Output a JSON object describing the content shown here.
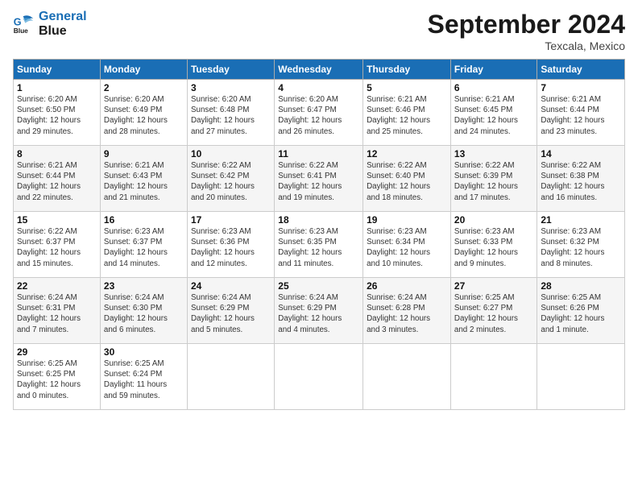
{
  "logo": {
    "line1": "General",
    "line2": "Blue"
  },
  "title": "September 2024",
  "subtitle": "Texcala, Mexico",
  "headers": [
    "Sunday",
    "Monday",
    "Tuesday",
    "Wednesday",
    "Thursday",
    "Friday",
    "Saturday"
  ],
  "weeks": [
    [
      {
        "day": "1",
        "info": "Sunrise: 6:20 AM\nSunset: 6:50 PM\nDaylight: 12 hours\nand 29 minutes."
      },
      {
        "day": "2",
        "info": "Sunrise: 6:20 AM\nSunset: 6:49 PM\nDaylight: 12 hours\nand 28 minutes."
      },
      {
        "day": "3",
        "info": "Sunrise: 6:20 AM\nSunset: 6:48 PM\nDaylight: 12 hours\nand 27 minutes."
      },
      {
        "day": "4",
        "info": "Sunrise: 6:20 AM\nSunset: 6:47 PM\nDaylight: 12 hours\nand 26 minutes."
      },
      {
        "day": "5",
        "info": "Sunrise: 6:21 AM\nSunset: 6:46 PM\nDaylight: 12 hours\nand 25 minutes."
      },
      {
        "day": "6",
        "info": "Sunrise: 6:21 AM\nSunset: 6:45 PM\nDaylight: 12 hours\nand 24 minutes."
      },
      {
        "day": "7",
        "info": "Sunrise: 6:21 AM\nSunset: 6:44 PM\nDaylight: 12 hours\nand 23 minutes."
      }
    ],
    [
      {
        "day": "8",
        "info": "Sunrise: 6:21 AM\nSunset: 6:44 PM\nDaylight: 12 hours\nand 22 minutes."
      },
      {
        "day": "9",
        "info": "Sunrise: 6:21 AM\nSunset: 6:43 PM\nDaylight: 12 hours\nand 21 minutes."
      },
      {
        "day": "10",
        "info": "Sunrise: 6:22 AM\nSunset: 6:42 PM\nDaylight: 12 hours\nand 20 minutes."
      },
      {
        "day": "11",
        "info": "Sunrise: 6:22 AM\nSunset: 6:41 PM\nDaylight: 12 hours\nand 19 minutes."
      },
      {
        "day": "12",
        "info": "Sunrise: 6:22 AM\nSunset: 6:40 PM\nDaylight: 12 hours\nand 18 minutes."
      },
      {
        "day": "13",
        "info": "Sunrise: 6:22 AM\nSunset: 6:39 PM\nDaylight: 12 hours\nand 17 minutes."
      },
      {
        "day": "14",
        "info": "Sunrise: 6:22 AM\nSunset: 6:38 PM\nDaylight: 12 hours\nand 16 minutes."
      }
    ],
    [
      {
        "day": "15",
        "info": "Sunrise: 6:22 AM\nSunset: 6:37 PM\nDaylight: 12 hours\nand 15 minutes."
      },
      {
        "day": "16",
        "info": "Sunrise: 6:23 AM\nSunset: 6:37 PM\nDaylight: 12 hours\nand 14 minutes."
      },
      {
        "day": "17",
        "info": "Sunrise: 6:23 AM\nSunset: 6:36 PM\nDaylight: 12 hours\nand 12 minutes."
      },
      {
        "day": "18",
        "info": "Sunrise: 6:23 AM\nSunset: 6:35 PM\nDaylight: 12 hours\nand 11 minutes."
      },
      {
        "day": "19",
        "info": "Sunrise: 6:23 AM\nSunset: 6:34 PM\nDaylight: 12 hours\nand 10 minutes."
      },
      {
        "day": "20",
        "info": "Sunrise: 6:23 AM\nSunset: 6:33 PM\nDaylight: 12 hours\nand 9 minutes."
      },
      {
        "day": "21",
        "info": "Sunrise: 6:23 AM\nSunset: 6:32 PM\nDaylight: 12 hours\nand 8 minutes."
      }
    ],
    [
      {
        "day": "22",
        "info": "Sunrise: 6:24 AM\nSunset: 6:31 PM\nDaylight: 12 hours\nand 7 minutes."
      },
      {
        "day": "23",
        "info": "Sunrise: 6:24 AM\nSunset: 6:30 PM\nDaylight: 12 hours\nand 6 minutes."
      },
      {
        "day": "24",
        "info": "Sunrise: 6:24 AM\nSunset: 6:29 PM\nDaylight: 12 hours\nand 5 minutes."
      },
      {
        "day": "25",
        "info": "Sunrise: 6:24 AM\nSunset: 6:29 PM\nDaylight: 12 hours\nand 4 minutes."
      },
      {
        "day": "26",
        "info": "Sunrise: 6:24 AM\nSunset: 6:28 PM\nDaylight: 12 hours\nand 3 minutes."
      },
      {
        "day": "27",
        "info": "Sunrise: 6:25 AM\nSunset: 6:27 PM\nDaylight: 12 hours\nand 2 minutes."
      },
      {
        "day": "28",
        "info": "Sunrise: 6:25 AM\nSunset: 6:26 PM\nDaylight: 12 hours\nand 1 minute."
      }
    ],
    [
      {
        "day": "29",
        "info": "Sunrise: 6:25 AM\nSunset: 6:25 PM\nDaylight: 12 hours\nand 0 minutes."
      },
      {
        "day": "30",
        "info": "Sunrise: 6:25 AM\nSunset: 6:24 PM\nDaylight: 11 hours\nand 59 minutes."
      },
      null,
      null,
      null,
      null,
      null
    ]
  ]
}
